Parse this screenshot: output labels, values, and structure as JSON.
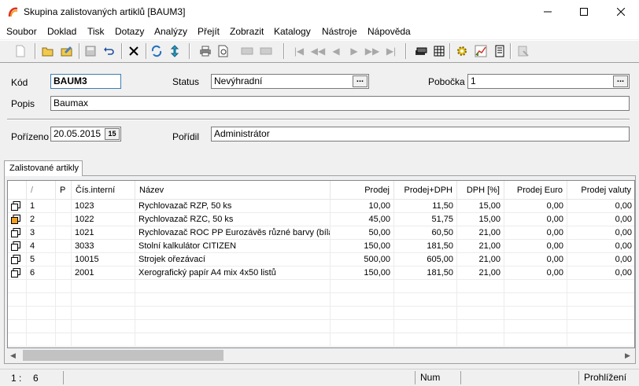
{
  "window": {
    "title": "Skupina zalistovaných artiklů [BAUM3]"
  },
  "menu": [
    "Soubor",
    "Doklad",
    "Tisk",
    "Dotazy",
    "Analýzy",
    "Přejít",
    "Zobrazit",
    "Katalogy",
    "Nástroje",
    "Nápověda"
  ],
  "form": {
    "kod_label": "Kód",
    "kod_value": "BAUM3",
    "status_label": "Status",
    "status_value": "Nevýhradní",
    "pobocka_label": "Pobočka",
    "pobocka_value": "1",
    "popis_label": "Popis",
    "popis_value": "Baumax",
    "porizeno_label": "Pořízeno",
    "porizeno_value": "20.05.2015",
    "calendar_glyph": "15",
    "poridil_label": "Pořídil",
    "poridil_value": "Administrátor",
    "dots": "..."
  },
  "tab": {
    "label": "Zalistované artikly"
  },
  "grid": {
    "headers": [
      "",
      "/",
      "P",
      "Čís.interní",
      "Název",
      "Prodej",
      "Prodej+DPH",
      "DPH [%]",
      "Prodej Euro",
      "Prodej valuty"
    ],
    "rows": [
      {
        "no": "1",
        "cis": "1023",
        "nazev": "Rychlovazač RZP, 50 ks",
        "prodej": "10,00",
        "prodej_dph": "11,50",
        "dph": "15,00",
        "euro": "0,00",
        "valuty": "0,00"
      },
      {
        "no": "2",
        "cis": "1022",
        "nazev": "Rychlovazač RZC, 50 ks",
        "prodej": "45,00",
        "prodej_dph": "51,75",
        "dph": "15,00",
        "euro": "0,00",
        "valuty": "0,00"
      },
      {
        "no": "3",
        "cis": "1021",
        "nazev": "Rychlovazač ROC PP Eurozávěs různé barvy (bílá,",
        "prodej": "50,00",
        "prodej_dph": "60,50",
        "dph": "21,00",
        "euro": "0,00",
        "valuty": "0,00"
      },
      {
        "no": "4",
        "cis": "3033",
        "nazev": "Stolní kalkulátor CITIZEN",
        "prodej": "150,00",
        "prodej_dph": "181,50",
        "dph": "21,00",
        "euro": "0,00",
        "valuty": "0,00"
      },
      {
        "no": "5",
        "cis": "10015",
        "nazev": "Strojek ořezávací",
        "prodej": "500,00",
        "prodej_dph": "605,00",
        "dph": "21,00",
        "euro": "0,00",
        "valuty": "0,00"
      },
      {
        "no": "6",
        "cis": "2001",
        "nazev": "Xerografický papír A4 mix 4x50 listů",
        "prodej": "150,00",
        "prodej_dph": "181,50",
        "dph": "21,00",
        "euro": "0,00",
        "valuty": "0,00"
      }
    ]
  },
  "statusbar": {
    "position": "1 :",
    "count": "6",
    "num": "Num",
    "mode": "Prohlížení"
  }
}
